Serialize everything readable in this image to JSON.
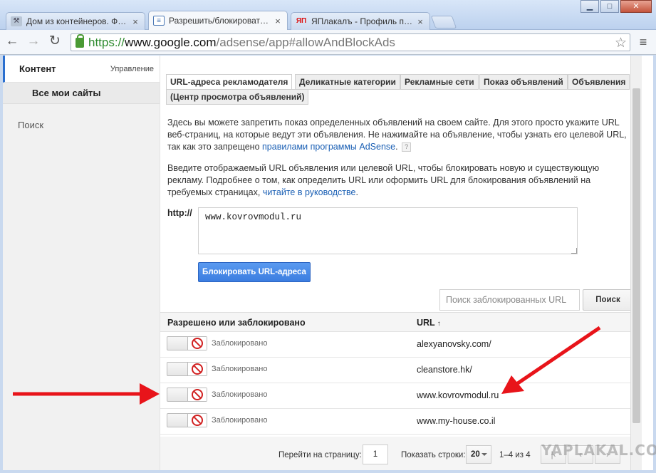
{
  "tabs": [
    {
      "title": "Дом из контейнеров. Фото",
      "icon": "hammer-icon",
      "fav": "",
      "active": false
    },
    {
      "title": "Разрешить/блокировать об",
      "icon": "page-icon",
      "fav": "",
      "active": true
    },
    {
      "title": "ЯПлакалъ - Профиль польз",
      "icon": "yaplakal-icon",
      "fav": "ЯП",
      "active": false
    }
  ],
  "window_controls": {
    "minimize": "▁",
    "maximize": "□",
    "close": "✕"
  },
  "address": {
    "scheme": "https://",
    "host": "www.google.com",
    "path": "/adsense/app#allowAndBlockAds"
  },
  "sidebar": {
    "title": "Контент",
    "manage": "Управление",
    "all_sites": "Все мои сайты",
    "search": "Поиск"
  },
  "content_tabs": [
    {
      "label": "URL-адреса рекламодателя",
      "active": true
    },
    {
      "label": "Деликатные категории",
      "active": false
    },
    {
      "label": "Рекламные сети",
      "active": false
    },
    {
      "label": "Показ объявлений",
      "active": false
    },
    {
      "label": "Объявления",
      "active": false
    },
    {
      "label": "(Центр просмотра объявлений)",
      "active": false
    }
  ],
  "intro": {
    "text": "Здесь вы можете запретить показ определенных объявлений на своем сайте. Для этого просто укажите URL веб-страниц, на которые ведут эти объявления. Не нажимайте на объявление, чтобы узнать его целевой URL, так как это запрещено ",
    "link": "правилами программы AdSense",
    "end": ".",
    "help": "?"
  },
  "instructions": {
    "text": "Введите отображаемый URL объявления или целевой URL, чтобы блокировать новую и существующую рекламу. Подробнее о том, как определить URL или оформить URL для блокирования объявлений на требуемых страницах, ",
    "link": "читайте в руководстве",
    "end": "."
  },
  "form": {
    "http_label": "http://",
    "url_value": "www.kovrovmodul.ru",
    "block_button": "Блокировать URL-адреса",
    "search_placeholder": "Поиск заблокированных URL",
    "search_button": "Поиск"
  },
  "table": {
    "col_status": "Разрешено или заблокировано",
    "col_url": "URL",
    "sort_arrow": "↑",
    "rows": [
      {
        "status": "Заблокировано",
        "url": "alexyanovsky.com/"
      },
      {
        "status": "Заблокировано",
        "url": "cleanstore.hk/"
      },
      {
        "status": "Заблокировано",
        "url": "www.kovrovmodul.ru"
      },
      {
        "status": "Заблокировано",
        "url": "www.my-house.co.il"
      }
    ]
  },
  "pagination": {
    "goto_label": "Перейти на страницу:",
    "page_value": "1",
    "rows_label": "Показать строки:",
    "rows_value": "20",
    "range": "1–4 из 4"
  },
  "watermark": "YAPLAKAL.COM",
  "colors": {
    "accent": "#2a6fcf",
    "annotation_arrow": "#e8141a",
    "block_button": "#3b7de0"
  }
}
